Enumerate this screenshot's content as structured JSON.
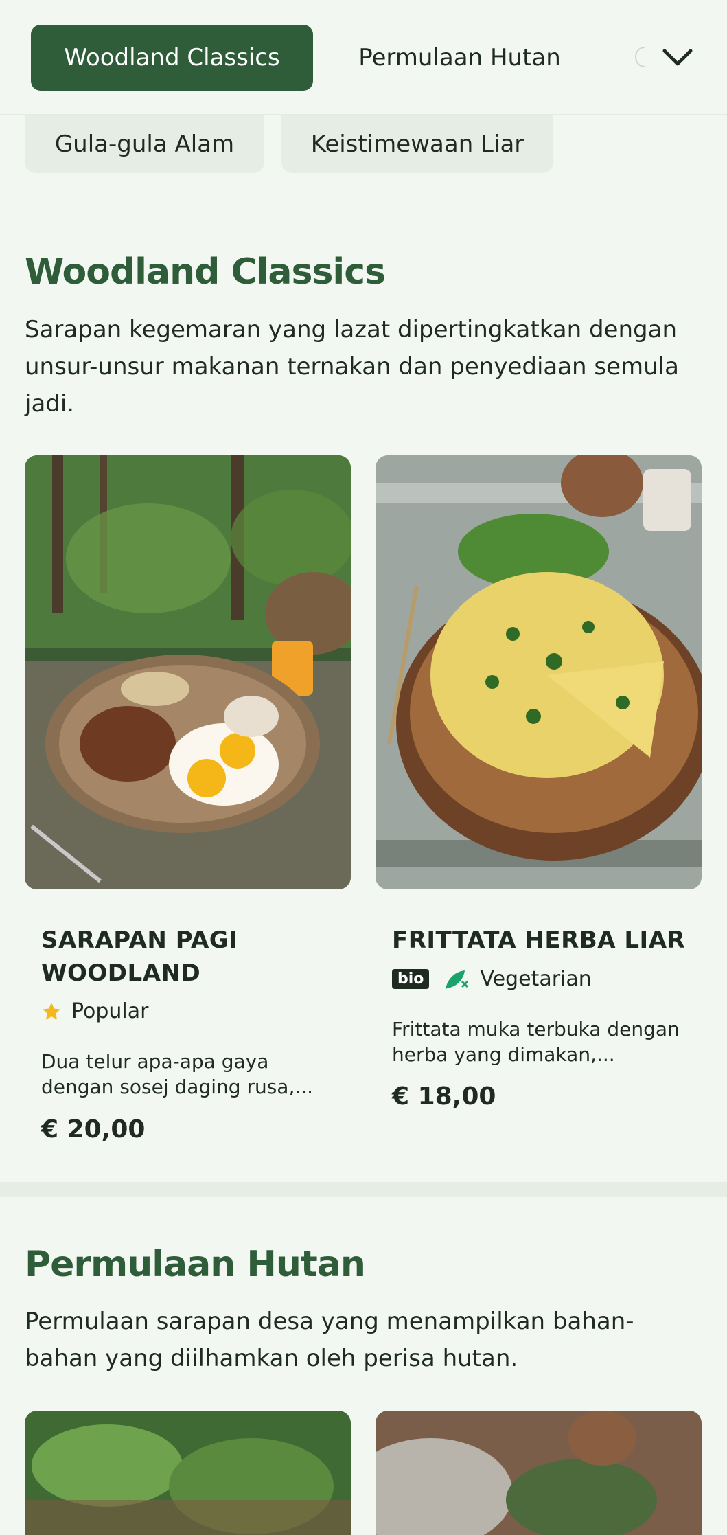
{
  "tabs": {
    "active": "Woodland Classics",
    "next": "Permulaan Hutan",
    "row2": [
      "Gula-gula Alam",
      "Keistimewaan Liar"
    ]
  },
  "sections": [
    {
      "title": "Woodland Classics",
      "description": "Sarapan kegemaran yang lazat dipertingkatkan dengan unsur-unsur makanan ternakan dan penyediaan semula jadi.",
      "items": [
        {
          "title_line1": "SARAPAN PAGI",
          "title_line2": "WOODLAND",
          "badge": "Popular",
          "desc_line1": "Dua telur apa-apa gaya",
          "desc_line2": "dengan sosej daging rusa,...",
          "price": "€ 20,00"
        },
        {
          "title_line1": "FRITTATA HERBA LIAR",
          "bio_label": "bio",
          "badge": "Vegetarian",
          "desc_line1": "Frittata muka terbuka dengan",
          "desc_line2": "herba yang dimakan,...",
          "price": "€ 18,00"
        }
      ]
    },
    {
      "title": "Permulaan Hutan",
      "description": "Permulaan sarapan desa yang menampilkan bahan-bahan yang diilhamkan oleh perisa hutan."
    }
  ],
  "colors": {
    "accent": "#2f5d3a",
    "background": "#f3f7f2",
    "star": "#f5b81c",
    "veg": "#1aa36a"
  }
}
